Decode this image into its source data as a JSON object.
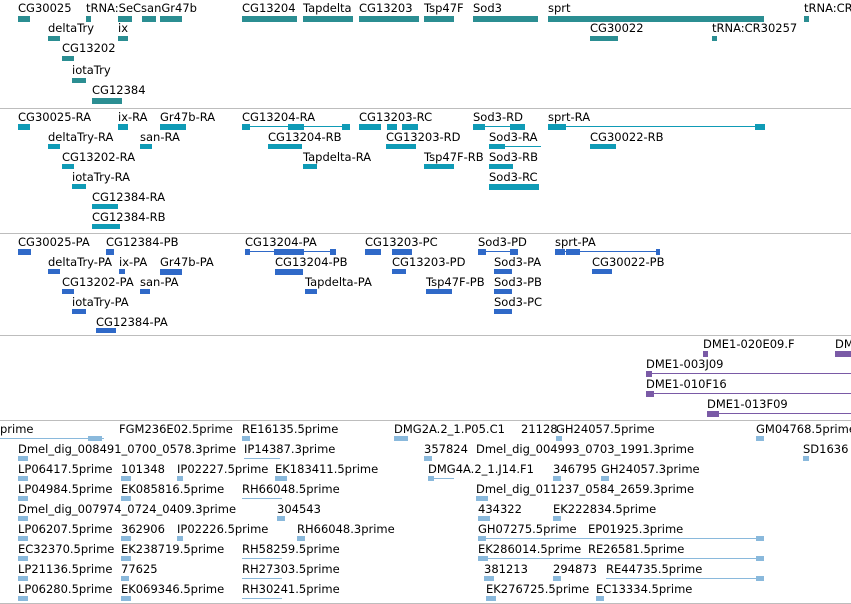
{
  "colors": {
    "gene": "#2b8e92",
    "transcript": "#0f9bb6",
    "protein": "#2f69c8",
    "bac": "#7a5aa6",
    "est": "#8ab9dc",
    "separator": "#bdbdbd"
  },
  "tracks": [
    {
      "id": "gene",
      "colorKey": "gene",
      "labels": [
        "CG30025",
        "tRNA:SeCsanGr47b",
        "CG13204",
        "Tapdelta",
        "CG13203",
        "Tsp47F",
        "Sod3",
        "sprt",
        "tRNA:CR",
        "deltaTry",
        "ix",
        "CG13202",
        "CG30022",
        "tRNA:CR30257",
        "iotaTry",
        "CG12384"
      ]
    },
    {
      "id": "transcript",
      "colorKey": "transcript",
      "labels": [
        "CG30025-RA",
        "ix-RA",
        "Gr47b-RA",
        "CG13204-RA",
        "CG13203-RC",
        "Sod3-RD",
        "sprt-RA",
        "deltaTry-RA",
        "san-RA",
        "CG13204-RB",
        "CG13203-RD",
        "Sod3-RA",
        "CG30022-RB",
        "CG13202-RA",
        "Tapdelta-RA",
        "Tsp47F-RB",
        "Sod3-RB",
        "iotaTry-RA",
        "Sod3-RC",
        "CG12384-RA",
        "CG12384-RB"
      ]
    },
    {
      "id": "protein",
      "colorKey": "protein",
      "labels": [
        "CG30025-PA",
        "CG12384-PB",
        "CG13204-PA",
        "CG13203-PC",
        "Sod3-PD",
        "sprt-PA",
        "deltaTry-PA",
        "ix-PA",
        "Gr47b-PA",
        "CG13204-PB",
        "CG13203-PD",
        "Sod3-PA",
        "CG30022-PB",
        "CG13202-PA",
        "san-PA",
        "Tapdelta-PA",
        "Tsp47F-PB",
        "Sod3-PB",
        "iotaTry-PA",
        "Sod3-PC",
        "CG12384-PA"
      ]
    },
    {
      "id": "bac",
      "colorKey": "bac",
      "labels": [
        "DME1-020E09.F",
        "DM",
        "DME1-003J09",
        "DME1-010F16",
        "DME1-013F09"
      ]
    },
    {
      "id": "est",
      "colorKey": "est",
      "labels": [
        "prime",
        "FGM236E02.5prime",
        "RE16135.5prime",
        "DMG2A.2_1.P05.C1",
        "21128",
        "GH24057.5prime",
        "GM04768.5prime",
        "Dmel_dig_008491_0700_0578.3prime",
        "IP14387.3prime",
        "357824",
        "Dmel_dig_004993_0703_1991.3prime",
        "SD1636",
        "LP06417.5prime",
        "101348",
        "IP02227.5prime",
        "EK183411.5prime",
        "DMG4A.2_1.J14.F1",
        "346795",
        "GH24057.3prime",
        "LP04984.5prime",
        "EK085816.5prime",
        "RH66048.5prime",
        "Dmel_dig_011237_0584_2659.3prime",
        "Dmel_dig_007974_0724_0409.3prime",
        "304543",
        "434322",
        "EK222834.5prime",
        "LP06207.5prime",
        "362906",
        "IP02226.5prime",
        "RH66048.3prime",
        "GH07275.5prime",
        "EP01925.3prime",
        "EC32370.5prime",
        "EK238719.5prime",
        "RH58259.5prime",
        "EK286014.5prime",
        "RE26581.5prime",
        "LP21136.5prime",
        "77625",
        "RH27303.5prime",
        "381213",
        "294873",
        "RE44735.5prime",
        "LP06280.5prime",
        "EK069346.5prime",
        "RH30241.5prime",
        "EK276725.5prime",
        "EC13334.5prime"
      ]
    }
  ]
}
